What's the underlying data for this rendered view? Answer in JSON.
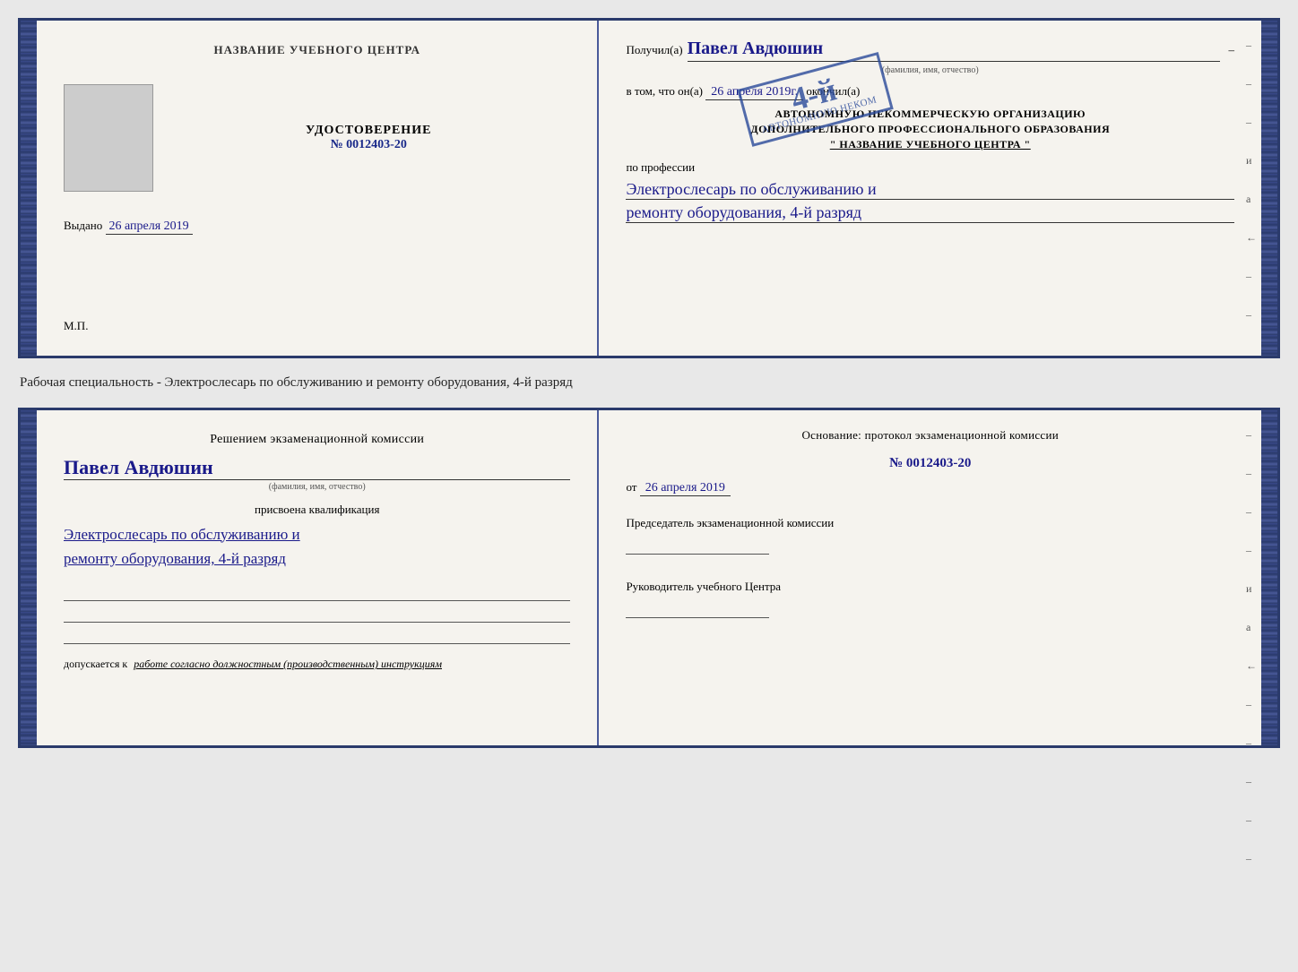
{
  "top_cert": {
    "left": {
      "header": "НАЗВАНИЕ УЧЕБНОГО ЦЕНТРА",
      "udost_title": "УДОСТОВЕРЕНИЕ",
      "udost_number": "№ 0012403-20",
      "issued_label": "Выдано",
      "issued_date": "26 апреля 2019",
      "mp_label": "М.П."
    },
    "right": {
      "poluchil_label": "Получил(а)",
      "name_handwritten": "Павел Авдюшин",
      "fio_hint": "(фамилия, имя, отчество)",
      "vtom_label": "в том, что он(а)",
      "date_handwritten": "26 апреля 2019г.",
      "okonchil_label": "окончил(а)",
      "stamp_num": "4-й",
      "stamp_text1": "АВ",
      "org_line1": "АВТОНОМНУЮ НЕКОММЕРЧЕСКУЮ ОРГАНИЗАЦИЮ",
      "org_line2": "ДОПОЛНИТЕЛЬНОГО ПРОФЕССИОНАЛЬНОГО ОБРАЗОВАНИЯ",
      "org_line3": "\" НАЗВАНИЕ УЧЕБНОГО ЦЕНТРА \"",
      "po_professii": "по профессии",
      "prof_line1": "Электрослесарь по обслуживанию и",
      "prof_line2": "ремонту оборудования, 4-й разряд"
    }
  },
  "description": "Рабочая специальность - Электрослесарь по обслуживанию и ремонту оборудования, 4-й разряд",
  "bottom_cert": {
    "left": {
      "komissia_title": "Решением экзаменационной комиссии",
      "name_handwritten": "Павел Авдюшин",
      "fio_hint": "(фамилия, имя, отчество)",
      "prisvoena": "присвоена квалификация",
      "qual_line1": "Электрослесарь по обслуживанию и",
      "qual_line2": "ремонту оборудования, 4-й разряд",
      "dopuskaetsya": "допускается к",
      "dopusk_italic": "работе согласно должностным (производственным) инструкциям"
    },
    "right": {
      "osnov_title": "Основание: протокол экзаменационной комиссии",
      "prot_number": "№ 0012403-20",
      "ot_label": "от",
      "ot_date": "26 апреля 2019",
      "chairman_title": "Председатель экзаменационной комиссии",
      "rukovoditel_title": "Руководитель учебного Центра"
    }
  },
  "dashes": [
    "-",
    "-",
    "-",
    "и",
    "а",
    "←",
    "-",
    "-",
    "-",
    "-",
    "-"
  ]
}
